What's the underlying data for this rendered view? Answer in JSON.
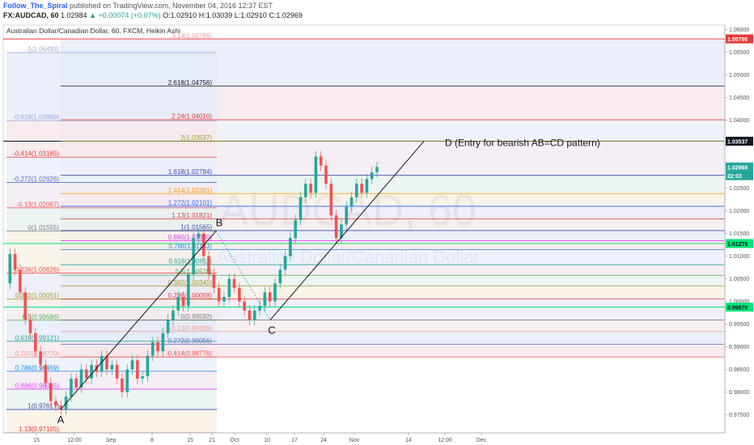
{
  "header": {
    "author": "Follow_The_Spiral",
    "published": "published on TradingView.com, November 04, 2016 12:37 EST",
    "symbol": "FX:AUDCAD, 60",
    "last": "1.02984",
    "change": "+0.00074 (+0.07%)",
    "o_label": "O:",
    "o": "1.02910",
    "h_label": "H:",
    "h": "1.03039",
    "l_label": "L:",
    "l": "1.02910",
    "c_label": "C:",
    "c": "1.02969"
  },
  "chart_data": {
    "type": "candlestick",
    "title": "Australian Dollar/Canadian Dollar, 60, FXCM, Heikin Ashi",
    "watermark_symbol": "AUDCAD, 60",
    "watermark_name": "Australian Dollar/Canadian Dollar",
    "ylim": [
      0.971,
      1.061
    ],
    "y_ticks": [
      "1.06000",
      "1.05500",
      "1.05000",
      "1.04500",
      "1.04000",
      "1.03500",
      "1.03000",
      "1.02500",
      "1.02000",
      "1.01500",
      "1.01000",
      "1.00500",
      "1.00000",
      "0.99500",
      "0.99000",
      "0.98500",
      "0.98000",
      "0.97500"
    ],
    "x_ticks": [
      "15",
      "12:00",
      "Sep",
      "8",
      "15",
      "21",
      "Oct",
      "10",
      "17",
      "24",
      "Nov",
      "14",
      "12:00",
      "Dec"
    ],
    "price_labels": [
      {
        "text": "1.05795",
        "value": 1.05795,
        "color": "#e53935"
      },
      {
        "text": "1.03537",
        "value": 1.03537,
        "color": "#131722"
      },
      {
        "text": "1.02969",
        "value": 1.02969,
        "color": "#26a69a"
      },
      {
        "text": "22:03",
        "value": 1.02775,
        "color": "#26a69a"
      },
      {
        "text": "1.01279",
        "value": 1.01279,
        "color": "#00e676"
      },
      {
        "text": "0.99876",
        "value": 0.99876,
        "color": "#00e676"
      }
    ],
    "horizontal_lines": [
      {
        "value": 1.05795,
        "color": "#e53935"
      },
      {
        "value": 1.03537,
        "color": "#131722"
      },
      {
        "value": 1.01279,
        "color": "#00e676"
      },
      {
        "value": 0.99876,
        "color": "#00e676"
      }
    ],
    "fib_left": {
      "levels": [
        {
          "label": "-1(1.05493)",
          "value": 1.05493,
          "color": "#9fa8da"
        },
        {
          "label": "-0.618(1.03989)",
          "value": 1.03989,
          "color": "#9fa8da"
        },
        {
          "label": "-0.414(1.03185)",
          "value": 1.03185,
          "color": "#e53935"
        },
        {
          "label": "-0.272(1.02626)",
          "value": 1.02626,
          "color": "#5c6bc0"
        },
        {
          "label": "-0.13(1.02067)",
          "value": 1.02067,
          "color": "#ef5350"
        },
        {
          "label": "0(1.01555)",
          "value": 1.01555,
          "color": "#787b86"
        },
        {
          "label": "0.236(1.00626)",
          "value": 1.00626,
          "color": "#ef5350"
        },
        {
          "label": "0.382(1.00051)",
          "value": 1.00051,
          "color": "#9e9d24"
        },
        {
          "label": "0.5(0.99586)",
          "value": 0.99586,
          "color": "#4caf50"
        },
        {
          "label": "0.618(0.99121)",
          "value": 0.99121,
          "color": "#26a69a"
        },
        {
          "label": "0.707(0.98770)",
          "value": 0.9877,
          "color": "#ef9a9a"
        },
        {
          "label": "0.786(0.98459)",
          "value": 0.98459,
          "color": "#1e88e5"
        },
        {
          "label": "0.886(0.98065)",
          "value": 0.98065,
          "color": "#e040fb"
        },
        {
          "label": "1(0.97617)",
          "value": 0.97617,
          "color": "#3949ab"
        },
        {
          "label": "1.13(0.97105)",
          "value": 0.97105,
          "color": "#e53935"
        }
      ]
    },
    "fib_right": {
      "levels": [
        {
          "label": "3.14(1.05786)",
          "value": 1.05786,
          "color": "#ef9a9a"
        },
        {
          "label": "2.618(1.04756)",
          "value": 1.04756,
          "color": "#131722"
        },
        {
          "label": "2.24(1.04010)",
          "value": 1.0401,
          "color": "#e53935"
        },
        {
          "label": "2(1.03537)",
          "value": 1.03537,
          "color": "#9e9d24"
        },
        {
          "label": "1.618(1.02784)",
          "value": 1.02784,
          "color": "#3949ab"
        },
        {
          "label": "1.414(1.02381)",
          "value": 1.02381,
          "color": "#ff9800"
        },
        {
          "label": "1.272(1.02101)",
          "value": 1.02101,
          "color": "#2962ff"
        },
        {
          "label": "1.13(1.01821)",
          "value": 1.01821,
          "color": "#e53935"
        },
        {
          "label": "1(1.01565)",
          "value": 1.01565,
          "color": "#3949ab"
        },
        {
          "label": "0.886(1.01340)",
          "value": 1.0134,
          "color": "#e040fb"
        },
        {
          "label": "0.786(1.01143)",
          "value": 1.01143,
          "color": "#1e88e5"
        },
        {
          "label": "0.618(1.00811)",
          "value": 1.00811,
          "color": "#26a69a"
        },
        {
          "label": "0.5(1.00578)",
          "value": 1.00578,
          "color": "#4caf50"
        },
        {
          "label": "0.382(1.00345)",
          "value": 1.00345,
          "color": "#9e9d24"
        },
        {
          "label": "0.236(1.00058)",
          "value": 1.00058,
          "color": "#e53935"
        },
        {
          "label": "0(0.99592)",
          "value": 0.99592,
          "color": "#787b86"
        },
        {
          "label": "-0.13(0.99336)",
          "value": 0.99336,
          "color": "#ef9a9a"
        },
        {
          "label": "-0.272(0.99056)",
          "value": 0.99056,
          "color": "#5c6bc0"
        },
        {
          "label": "-0.414(0.98776)",
          "value": 0.98776,
          "color": "#ef5350"
        }
      ]
    },
    "points": [
      {
        "label": "A",
        "value": 0.97617
      },
      {
        "label": "B",
        "value": 1.01555
      },
      {
        "label": "C",
        "value": 0.99592
      },
      {
        "label": "D (Entry for bearish AB=CD pattern)",
        "value": 1.03537
      }
    ],
    "pattern_line_ab": [
      0.97617,
      1.01555
    ],
    "pattern_line_cd": [
      0.99592,
      1.03537
    ],
    "price_path": [
      1.004,
      1.0105,
      1.007,
      1.002,
      0.996,
      0.993,
      0.989,
      0.986,
      0.982,
      0.978,
      0.977,
      0.9762,
      0.979,
      0.983,
      0.981,
      0.985,
      0.983,
      0.986,
      0.9845,
      0.988,
      0.985,
      0.986,
      0.983,
      0.98,
      0.985,
      0.987,
      0.983,
      0.9835,
      0.988,
      0.991,
      0.989,
      0.993,
      0.996,
      0.998,
      1.001,
      0.999,
      1.006,
      1.014,
      1.015,
      1.01,
      1.006,
      1.003,
      1.0,
      1.001,
      1.005,
      1.003,
      1.0,
      0.998,
      0.996,
      0.998,
      0.999,
      1.002,
      1.0,
      1.004,
      1.007,
      1.01,
      1.014,
      1.018,
      1.023,
      1.026,
      1.024,
      1.032,
      1.03,
      1.026,
      1.019,
      1.014,
      1.017,
      1.021,
      1.023,
      1.026,
      1.024,
      1.027,
      1.0285,
      1.0297
    ]
  }
}
